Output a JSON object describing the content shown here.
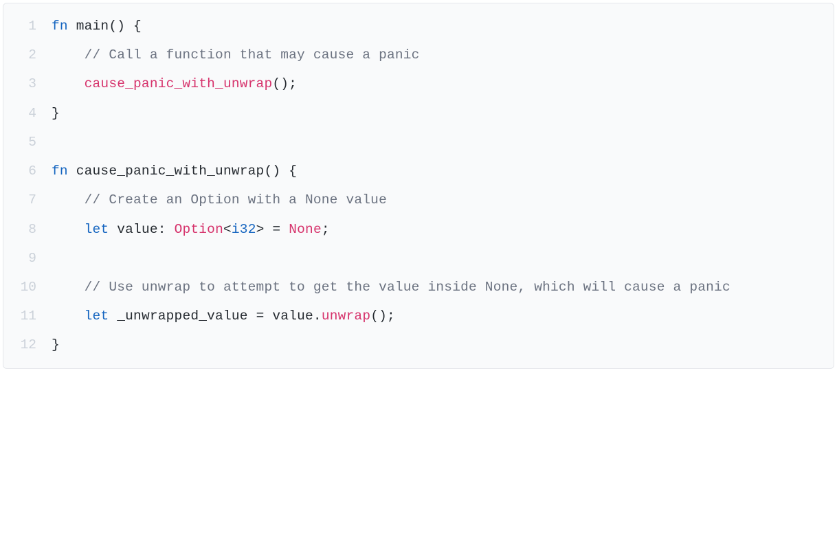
{
  "code": {
    "lines": [
      {
        "n": "1",
        "indent": 0,
        "tokens": [
          {
            "c": "tok-kw",
            "t": "fn"
          },
          {
            "c": "",
            "t": " "
          },
          {
            "c": "tok-fn",
            "t": "main"
          },
          {
            "c": "tok-punc",
            "t": "()"
          },
          {
            "c": "",
            "t": " "
          },
          {
            "c": "tok-punc",
            "t": "{"
          }
        ]
      },
      {
        "n": "2",
        "indent": 1,
        "tokens": [
          {
            "c": "tok-comment",
            "t": "// Call a function that may cause a panic"
          }
        ]
      },
      {
        "n": "3",
        "indent": 1,
        "tokens": [
          {
            "c": "tok-call",
            "t": "cause_panic_with_unwrap"
          },
          {
            "c": "tok-punc",
            "t": "();"
          }
        ]
      },
      {
        "n": "4",
        "indent": 0,
        "tokens": [
          {
            "c": "tok-punc",
            "t": "}"
          }
        ]
      },
      {
        "n": "5",
        "indent": 0,
        "tokens": []
      },
      {
        "n": "6",
        "indent": 0,
        "tokens": [
          {
            "c": "tok-kw",
            "t": "fn"
          },
          {
            "c": "",
            "t": " "
          },
          {
            "c": "tok-fn",
            "t": "cause_panic_with_unwrap"
          },
          {
            "c": "tok-punc",
            "t": "()"
          },
          {
            "c": "",
            "t": " "
          },
          {
            "c": "tok-punc",
            "t": "{"
          }
        ]
      },
      {
        "n": "7",
        "indent": 1,
        "tokens": [
          {
            "c": "tok-comment",
            "t": "// Create an Option with a None value"
          }
        ]
      },
      {
        "n": "8",
        "indent": 1,
        "tokens": [
          {
            "c": "tok-kw",
            "t": "let"
          },
          {
            "c": "",
            "t": " "
          },
          {
            "c": "tok-var",
            "t": "value"
          },
          {
            "c": "tok-punc",
            "t": ":"
          },
          {
            "c": "",
            "t": " "
          },
          {
            "c": "tok-type",
            "t": "Option"
          },
          {
            "c": "tok-punc",
            "t": "<"
          },
          {
            "c": "tok-gparam",
            "t": "i32"
          },
          {
            "c": "tok-punc",
            "t": ">"
          },
          {
            "c": "",
            "t": " "
          },
          {
            "c": "tok-op",
            "t": "="
          },
          {
            "c": "",
            "t": " "
          },
          {
            "c": "tok-const",
            "t": "None"
          },
          {
            "c": "tok-punc",
            "t": ";"
          }
        ]
      },
      {
        "n": "9",
        "indent": 0,
        "tokens": []
      },
      {
        "n": "10",
        "indent": 1,
        "tokens": [
          {
            "c": "tok-comment",
            "t": "// Use unwrap to attempt to get the value inside None, which will cause a panic"
          }
        ]
      },
      {
        "n": "11",
        "indent": 1,
        "tokens": [
          {
            "c": "tok-kw",
            "t": "let"
          },
          {
            "c": "",
            "t": " "
          },
          {
            "c": "tok-var",
            "t": "_unwrapped_value"
          },
          {
            "c": "",
            "t": " "
          },
          {
            "c": "tok-op",
            "t": "="
          },
          {
            "c": "",
            "t": " "
          },
          {
            "c": "tok-var",
            "t": "value"
          },
          {
            "c": "tok-punc",
            "t": "."
          },
          {
            "c": "tok-call",
            "t": "unwrap"
          },
          {
            "c": "tok-punc",
            "t": "();"
          }
        ]
      },
      {
        "n": "12",
        "indent": 0,
        "tokens": [
          {
            "c": "tok-punc",
            "t": "}"
          }
        ]
      }
    ],
    "indent_unit": "    "
  }
}
